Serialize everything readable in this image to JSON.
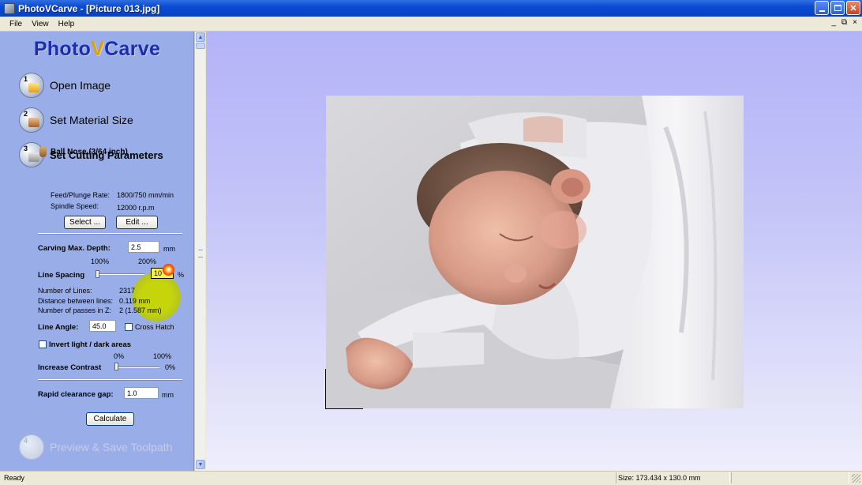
{
  "window": {
    "title": "PhotoVCarve - [Picture 013.jpg]"
  },
  "menu": {
    "items": [
      "File",
      "View",
      "Help"
    ],
    "mdi_controls": [
      "_",
      "7",
      "×"
    ]
  },
  "panel": {
    "logo": {
      "part1": "Photo",
      "part2": "V",
      "part3": "Carve"
    },
    "steps": [
      {
        "num": "1",
        "label": "Open Image"
      },
      {
        "num": "2",
        "label": "Set Material Size"
      },
      {
        "num": "3",
        "label": "Set Cutting Parameters"
      },
      {
        "num": "4",
        "label": "Preview & Save Toolpath"
      }
    ],
    "tool": {
      "name": "Ball Nose (3/64 inch)",
      "feed_label": "Feed/Plunge Rate:",
      "feed_value": "1800/750 mm/min",
      "spindle_label": "Spindle Speed:",
      "spindle_value": "12000 r.p.m",
      "select_button": "Select ...",
      "edit_button": "Edit ..."
    },
    "carving": {
      "label": "Carving Max. Depth:",
      "value": "2.5",
      "unit": "mm"
    },
    "line_spacing": {
      "label": "Line Spacing",
      "min_label": "100%",
      "max_label": "200%",
      "value": "10",
      "unit": "%"
    },
    "stats": {
      "lines_label": "Number of Lines:",
      "lines_value": "2317",
      "distance_label": "Distance between lines:",
      "distance_value": "0.119 mm",
      "passes_label": "Number of passes in Z:",
      "passes_value": "2 (1.587 mm)"
    },
    "line_angle": {
      "label": "Line Angle:",
      "value": "45.0",
      "crosshatch_label": "Cross Hatch",
      "crosshatch_checked": false
    },
    "invert": {
      "label": "Invert light / dark areas",
      "checked": false
    },
    "contrast": {
      "label": "Increase Contrast",
      "min_label": "0%",
      "max_label": "100%",
      "value_label": "0%",
      "level": 0
    },
    "rapid": {
      "label": "Rapid clearance gap:",
      "value": "1.0",
      "unit": "mm"
    },
    "calculate_button": "Calculate"
  },
  "status": {
    "text": "Ready",
    "size": "Size: 173.434 x 130.0 mm"
  }
}
